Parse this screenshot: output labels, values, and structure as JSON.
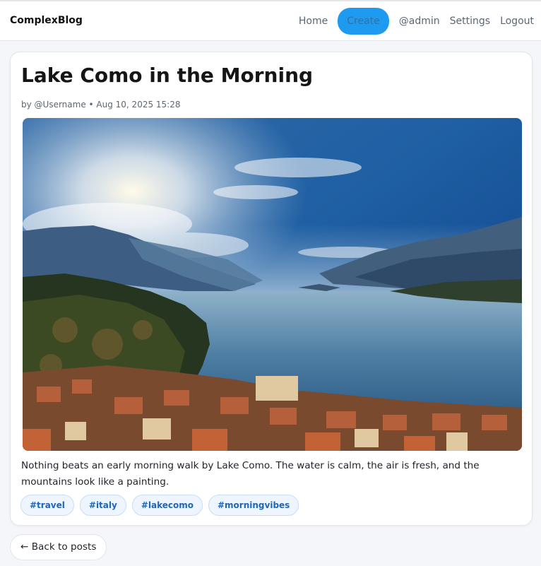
{
  "header": {
    "brand": "ComplexBlog",
    "nav": {
      "home": "Home",
      "create": "Create",
      "user": "@admin",
      "settings": "Settings",
      "logout": "Logout"
    }
  },
  "post": {
    "title": "Lake Como in the Morning",
    "meta": "by @Username • Aug 10, 2025 15:28",
    "body": "Nothing beats an early morning walk by Lake Como. The water is calm, the air is fresh, and the mountains look like a painting.",
    "tags": [
      "#travel",
      "#italy",
      "#lakecomo",
      "#morningvibes"
    ]
  },
  "footer": {
    "back_label": "← Back to posts"
  },
  "colors": {
    "accent": "#1e9bf0",
    "tag_text": "#1f66b8",
    "tag_bg": "#eef5fe"
  }
}
